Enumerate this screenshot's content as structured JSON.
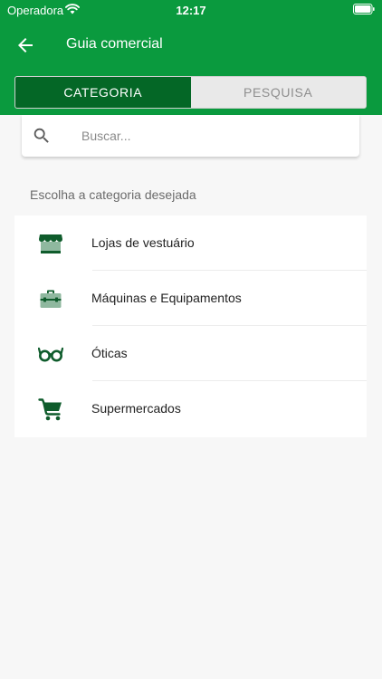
{
  "status_bar": {
    "carrier": "Operadora",
    "time": "12:17"
  },
  "header": {
    "title": "Guia comercial"
  },
  "tabs": [
    {
      "label": "CATEGORIA",
      "active": true
    },
    {
      "label": "PESQUISA",
      "active": false
    }
  ],
  "search": {
    "placeholder": "Buscar...",
    "value": ""
  },
  "section_label": "Escolha a categoria desejada",
  "categories": [
    {
      "label": "Lojas de vestuário",
      "icon": "storefront-icon"
    },
    {
      "label": "Máquinas e Equipamentos",
      "icon": "toolbox-icon"
    },
    {
      "label": "Óticas",
      "icon": "glasses-icon"
    },
    {
      "label": "Supermercados",
      "icon": "shopping-cart-icon"
    }
  ],
  "colors": {
    "header_green": "#0a9a3e",
    "active_tab": "#046726",
    "icon_dark": "#0f5c2c",
    "icon_light": "#8fb89f"
  }
}
